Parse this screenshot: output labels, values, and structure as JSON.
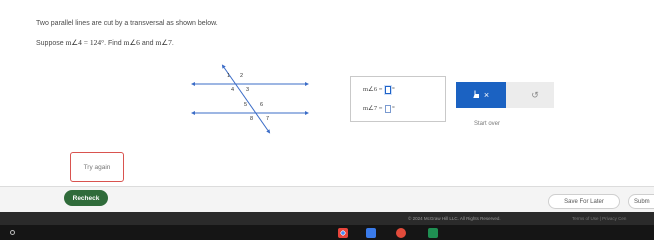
{
  "problem": {
    "intro": "Two parallel lines are cut by a transversal as shown below.",
    "suppose_word": "Suppose",
    "given_angle": "m∠4 = 124°",
    "find_word": ". Find",
    "find_angle_1": "m∠6",
    "and_word": "and",
    "find_angle_2": "m∠7",
    "end_period": "."
  },
  "diagram": {
    "angle_labels": [
      "1",
      "2",
      "4",
      "3",
      "5",
      "6",
      "8",
      "7"
    ]
  },
  "answers": {
    "row1_label": "m∠6 =",
    "row1_unit": "°",
    "row2_label": "m∠7 =",
    "row2_unit": "°"
  },
  "toolbar": {
    "check_icon": "pointer-hand",
    "clear_symbol": "×",
    "undo_symbol": "↺"
  },
  "start_over_label": "Start over",
  "try_again_label": "Try again",
  "footer": {
    "recheck_label": "Recheck",
    "save_later_label": "Save For Later",
    "submit_label": "Subm",
    "copyright": "© 2024 McGraw Hill LLC. All Rights Reserved.",
    "links": "Terms of Use  |  Privacy Cen"
  },
  "colors": {
    "accent_blue": "#1b62c2",
    "recheck_green": "#2f6b3a",
    "try_again_border": "#d9534f"
  }
}
